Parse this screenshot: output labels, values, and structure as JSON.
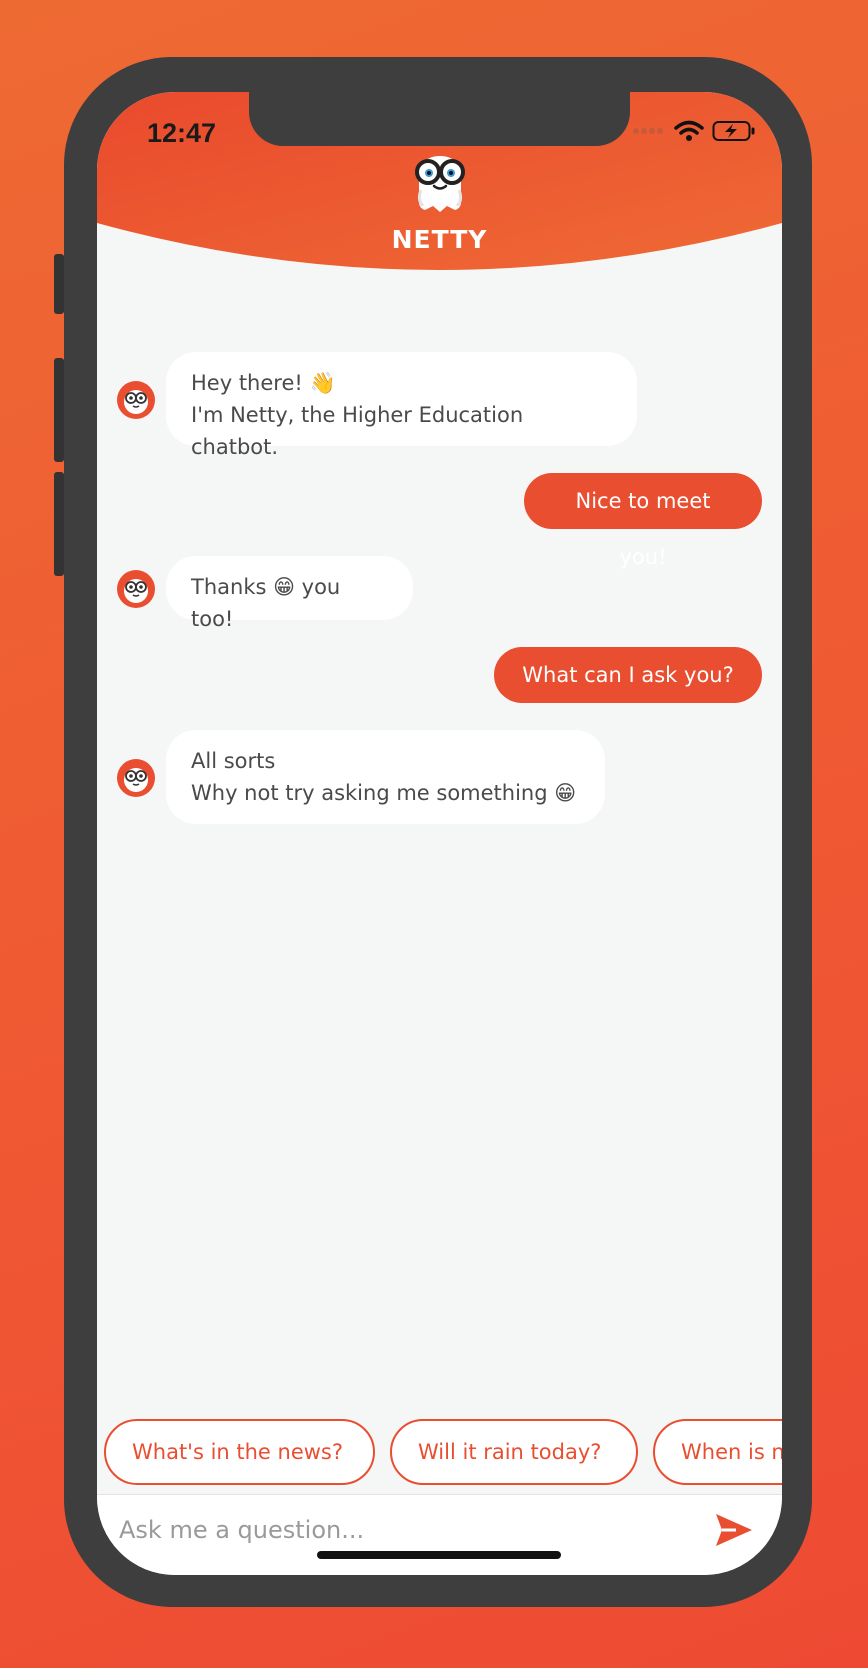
{
  "status_bar": {
    "time": "12:47"
  },
  "header": {
    "title": "NETTY"
  },
  "colors": {
    "accent": "#e94e31",
    "background_gradient": [
      "#ee6a33",
      "#ee4a33"
    ],
    "chat_bg": "#f5f6f6"
  },
  "messages": [
    {
      "from": "bot",
      "lines": [
        "Hey there! 👋",
        "I'm Netty, the Higher Education chatbot."
      ]
    },
    {
      "from": "user",
      "text": "Nice to meet you!"
    },
    {
      "from": "bot",
      "lines": [
        "Thanks 😁 you too!"
      ]
    },
    {
      "from": "user",
      "text": "What can I ask you?"
    },
    {
      "from": "bot",
      "lines": [
        "All sorts",
        "Why not try asking me something 😁"
      ]
    }
  ],
  "suggestions": [
    "What's in the news?",
    "Will it rain today?",
    "When is n"
  ],
  "input": {
    "placeholder": "Ask me a question...",
    "value": ""
  },
  "icons": {
    "send": "send-icon",
    "wifi": "wifi-icon",
    "battery": "battery-charging-icon",
    "signal": "signal-icon"
  }
}
